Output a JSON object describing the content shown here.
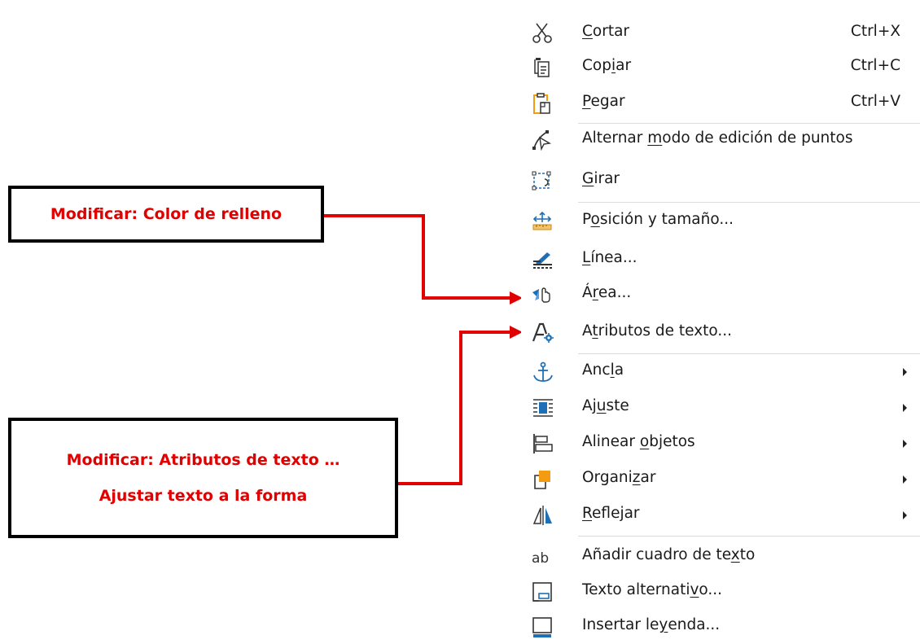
{
  "callouts": {
    "fill": "Modificar: Color de relleno",
    "text_attr_line1": "Modificar: Atributos de texto …",
    "text_attr_line2": "Ajustar texto a la forma"
  },
  "colors": {
    "annotation_red": "#e00000",
    "menu_icon_blue": "#1f6fb6",
    "menu_icon_orange": "#f39c12"
  },
  "menu": {
    "items": [
      {
        "label": "Cortar",
        "underline": "C",
        "shortcut": "Ctrl+X",
        "icon": "scissors-icon"
      },
      {
        "label": "Copiar",
        "underline": "i",
        "shortcut": "Ctrl+C",
        "icon": "copy-icon"
      },
      {
        "label": "Pegar",
        "underline": "P",
        "shortcut": "Ctrl+V",
        "icon": "paste-icon"
      },
      {
        "label": "Alternar modo de edición de puntos",
        "underline": "m",
        "icon": "edit-points-icon"
      },
      {
        "label": "Girar",
        "underline": "G",
        "icon": "rotate-icon"
      },
      {
        "label": "Posición y tamaño...",
        "underline": "o",
        "icon": "position-size-icon"
      },
      {
        "label": "Línea...",
        "underline": "L",
        "icon": "line-icon"
      },
      {
        "label": "Área...",
        "underline": "r",
        "icon": "area-icon"
      },
      {
        "label": "Atributos de texto...",
        "underline": "t",
        "icon": "text-attributes-icon"
      },
      {
        "label": "Ancla",
        "underline": "l",
        "icon": "anchor-icon",
        "submenu": true
      },
      {
        "label": "Ajuste",
        "underline": "u",
        "icon": "wrap-icon",
        "submenu": true
      },
      {
        "label": "Alinear objetos",
        "underline": "o",
        "icon": "align-objects-icon",
        "submenu": true
      },
      {
        "label": "Organizar",
        "underline": "z",
        "icon": "arrange-icon",
        "submenu": true
      },
      {
        "label": "Reflejar",
        "underline": "R",
        "icon": "flip-icon",
        "submenu": true
      },
      {
        "label": "Añadir cuadro de texto",
        "underline": "x",
        "icon": "text-box-icon"
      },
      {
        "label": "Texto alternativo...",
        "underline": "v",
        "icon": "alt-text-icon"
      },
      {
        "label": "Insertar leyenda...",
        "underline": "y",
        "icon": "caption-icon"
      }
    ]
  }
}
